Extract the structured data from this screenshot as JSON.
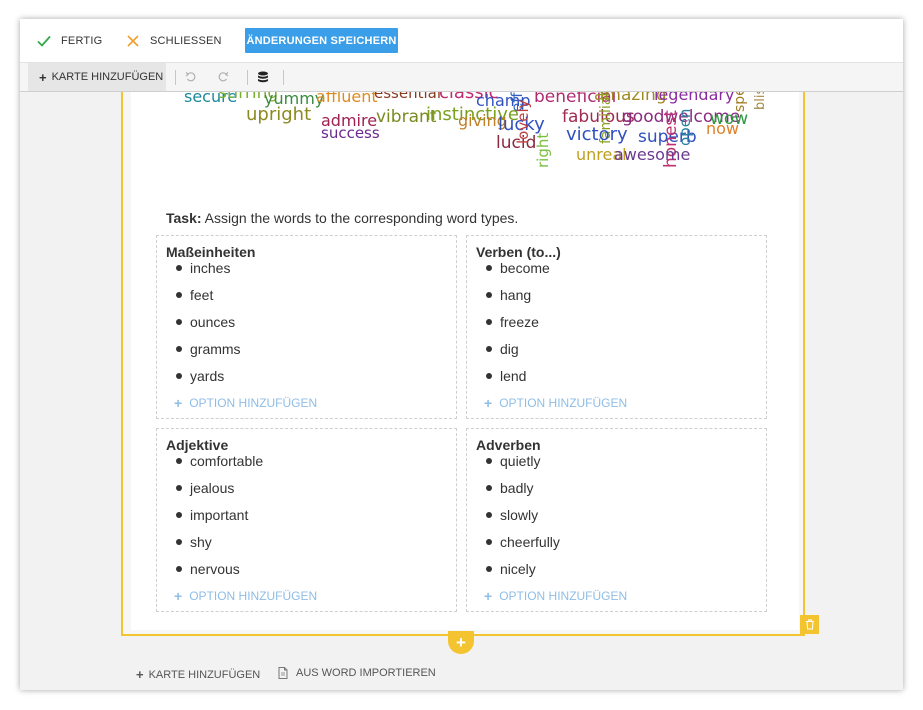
{
  "topbar": {
    "done_label": "FERTIG",
    "close_label": "SCHLIESSEN",
    "save_label": "ÄNDERUNGEN SPEICHERN"
  },
  "toolbar": {
    "add_card_label": "KARTE HINZUFÜGEN"
  },
  "wordcloud": {
    "words": [
      "secure",
      "stirring",
      "yummy",
      "affluent",
      "essential",
      "classic",
      "champ",
      "effort",
      "beneficial",
      "amazing",
      "legendary",
      "special",
      "bliss",
      "upright",
      "admire",
      "vibrant",
      "instinctive",
      "giving",
      "lucky",
      "lucid",
      "lovely",
      "fabulous",
      "familiar",
      "goodwelcome",
      "wow",
      "success",
      "right",
      "victory",
      "superb",
      "honest",
      "open",
      "now",
      "unreal",
      "awesome"
    ]
  },
  "task": {
    "label": "Task:",
    "text": "Assign the words to the corresponding word types."
  },
  "categories": [
    {
      "title": "Maßeinheiten",
      "items": [
        "inches",
        "feet",
        "ounces",
        "gramms",
        "yards"
      ],
      "add_label": "OPTION HINZUFÜGEN"
    },
    {
      "title": "Verben (to...)",
      "items": [
        "become",
        "hang",
        "freeze",
        "dig",
        "lend"
      ],
      "add_label": "OPTION HINZUFÜGEN"
    },
    {
      "title": "Adjektive",
      "items": [
        "comfortable",
        "jealous",
        "important",
        "shy",
        "nervous"
      ],
      "add_label": "OPTION HINZUFÜGEN"
    },
    {
      "title": "Adverben",
      "items": [
        "quietly",
        "badly",
        "slowly",
        "cheerfully",
        "nicely"
      ],
      "add_label": "OPTION HINZUFÜGEN"
    }
  ],
  "bottom": {
    "add_card_label": "KARTE HINZUFÜGEN",
    "import_label": "AUS WORD IMPORTIEREN"
  },
  "colors": {
    "accent": "#3b9ee8",
    "card_border": "#f4c430",
    "check": "#2eaa4a",
    "close": "#f0a030",
    "add_option": "#8fbde6"
  }
}
